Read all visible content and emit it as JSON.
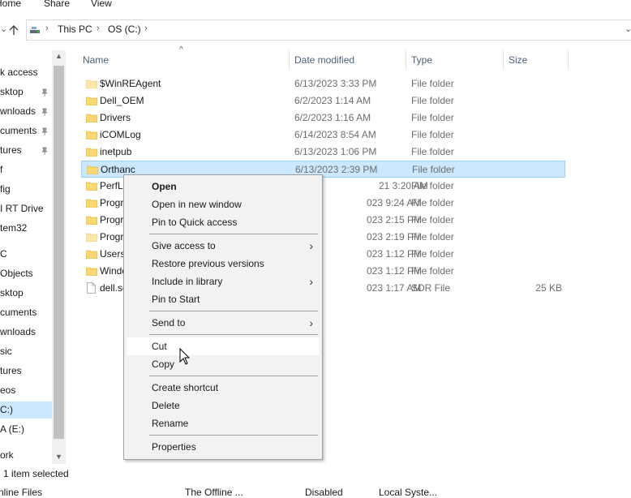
{
  "ribbon": {
    "tabs": [
      "Home",
      "Share",
      "View"
    ]
  },
  "address": {
    "crumbs": [
      "This PC",
      "OS (C:)"
    ]
  },
  "nav": {
    "items": [
      {
        "label": "k access",
        "pinned": false
      },
      {
        "label": "sktop",
        "pinned": true
      },
      {
        "label": "wnloads",
        "pinned": true
      },
      {
        "label": "cuments",
        "pinned": true
      },
      {
        "label": "tures",
        "pinned": true
      },
      {
        "label": "f",
        "pinned": false
      },
      {
        "label": "fig",
        "pinned": false
      },
      {
        "label": "I RT Drive",
        "pinned": false
      },
      {
        "label": "tem32",
        "pinned": false
      },
      {
        "label": "C",
        "pinned": false
      },
      {
        "label": "Objects",
        "pinned": false
      },
      {
        "label": "sktop",
        "pinned": false
      },
      {
        "label": "cuments",
        "pinned": false
      },
      {
        "label": "wnloads",
        "pinned": false
      },
      {
        "label": "sic",
        "pinned": false
      },
      {
        "label": "tures",
        "pinned": false
      },
      {
        "label": "eos",
        "pinned": false
      },
      {
        "label": "C:)",
        "pinned": false,
        "selected": true
      },
      {
        "label": "A (E:)",
        "pinned": false
      },
      {
        "label": "ork",
        "pinned": false
      }
    ]
  },
  "columns": {
    "name": "Name",
    "date": "Date modified",
    "type": "Type",
    "size": "Size"
  },
  "files": [
    {
      "name": "$WinREAgent",
      "date": "6/13/2023 3:33 PM",
      "type": "File folder",
      "size": "",
      "icon": "folder-light-icon"
    },
    {
      "name": "Dell_OEM",
      "date": "6/2/2023 1:14 AM",
      "type": "File folder",
      "size": "",
      "icon": "folder-icon"
    },
    {
      "name": "Drivers",
      "date": "6/2/2023 1:16 AM",
      "type": "File folder",
      "size": "",
      "icon": "folder-icon"
    },
    {
      "name": "iCOMLog",
      "date": "6/14/2023 8:54 AM",
      "type": "File folder",
      "size": "",
      "icon": "folder-icon"
    },
    {
      "name": "inetpub",
      "date": "6/13/2023 1:06 PM",
      "type": "File folder",
      "size": "",
      "icon": "folder-icon"
    },
    {
      "name": "Orthanc",
      "date": "6/13/2023 2:39 PM",
      "type": "File folder",
      "size": "",
      "icon": "folder-icon",
      "selected": true
    },
    {
      "name": "PerfLo",
      "date": "21 3:20 AM",
      "type": "File folder",
      "size": "",
      "icon": "folder-icon"
    },
    {
      "name": "Progr",
      "date": "023 9:24 AM",
      "type": "File folder",
      "size": "",
      "icon": "folder-icon"
    },
    {
      "name": "Progr",
      "date": "023 2:15 PM",
      "type": "File folder",
      "size": "",
      "icon": "folder-icon"
    },
    {
      "name": "Progr",
      "date": "023 2:19 PM",
      "type": "File folder",
      "size": "",
      "icon": "folder-light-icon"
    },
    {
      "name": "Users",
      "date": "023 1:12 PM",
      "type": "File folder",
      "size": "",
      "icon": "folder-icon"
    },
    {
      "name": "Windo",
      "date": "023 1:12 PM",
      "type": "File folder",
      "size": "",
      "icon": "folder-icon"
    },
    {
      "name": "dell.sc",
      "date": "023 1:17 AM",
      "type": "SDR File",
      "size": "25 KB",
      "icon": "file-icon"
    }
  ],
  "context_menu": {
    "groups": [
      [
        {
          "label": "Open",
          "bold": true
        },
        {
          "label": "Open in new window"
        },
        {
          "label": "Pin to Quick access"
        }
      ],
      [
        {
          "label": "Give access to",
          "submenu": true
        },
        {
          "label": "Restore previous versions"
        },
        {
          "label": "Include in library",
          "submenu": true
        },
        {
          "label": "Pin to Start"
        }
      ],
      [
        {
          "label": "Send to",
          "submenu": true
        }
      ],
      [
        {
          "label": "Cut",
          "hover": true
        },
        {
          "label": "Copy"
        }
      ],
      [
        {
          "label": "Create shortcut"
        },
        {
          "label": "Delete"
        },
        {
          "label": "Rename"
        }
      ],
      [
        {
          "label": "Properties"
        }
      ]
    ]
  },
  "status": {
    "selection": "1 item selected"
  },
  "bottom_row": {
    "name": "nline Files",
    "desc": "The Offline ...",
    "state": "Disabled",
    "account": "Local Syste..."
  },
  "colors": {
    "selection": "#cce8ff",
    "selection_border": "#99d1ff",
    "folder": "#f8d775",
    "folder_light": "#fbe7a9",
    "header_text": "#4c607a"
  }
}
